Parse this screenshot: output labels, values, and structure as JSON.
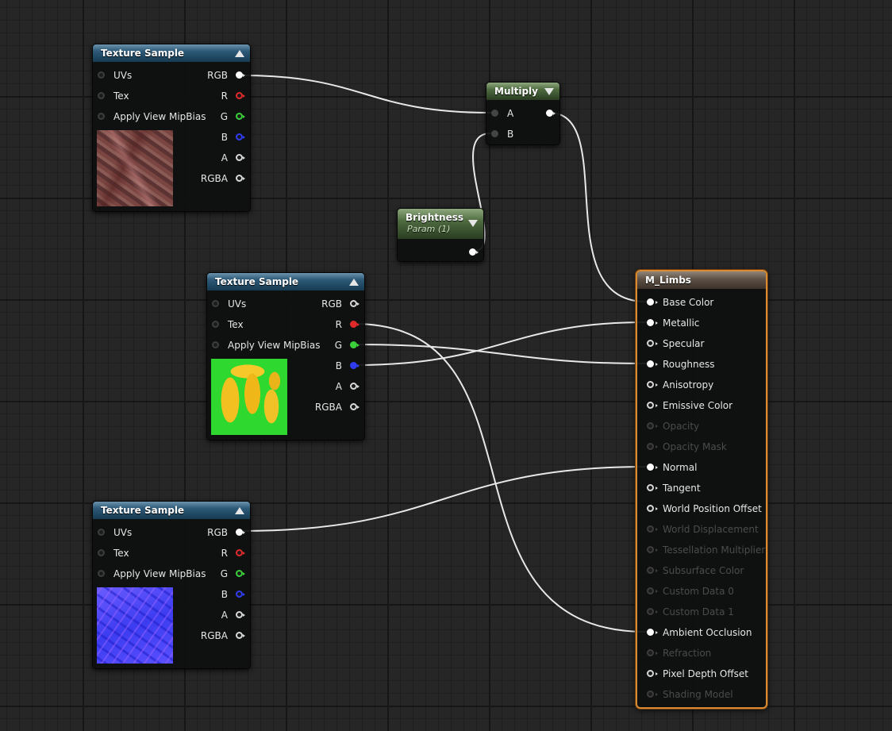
{
  "texture_sample_1": {
    "title": "Texture Sample",
    "inputs": [
      "UVs",
      "Tex",
      "Apply View MipBias"
    ],
    "outputs": [
      "RGB",
      "R",
      "G",
      "B",
      "A",
      "RGBA"
    ],
    "preview_icon": "texture-preview-diffuse"
  },
  "texture_sample_2": {
    "title": "Texture Sample",
    "inputs": [
      "UVs",
      "Tex",
      "Apply View MipBias"
    ],
    "outputs": [
      "RGB",
      "R",
      "G",
      "B",
      "A",
      "RGBA"
    ],
    "preview_icon": "texture-preview-mask"
  },
  "texture_sample_3": {
    "title": "Texture Sample",
    "inputs": [
      "UVs",
      "Tex",
      "Apply View MipBias"
    ],
    "outputs": [
      "RGB",
      "R",
      "G",
      "B",
      "A",
      "RGBA"
    ],
    "preview_icon": "texture-preview-normal"
  },
  "multiply": {
    "title": "Multiply",
    "inputs": [
      "A",
      "B"
    ]
  },
  "brightness": {
    "title": "Brightness",
    "subtitle": "Param (1)"
  },
  "material": {
    "title": "M_Limbs",
    "pins": [
      {
        "label": "Base Color",
        "enabled": true,
        "connected": true
      },
      {
        "label": "Metallic",
        "enabled": true,
        "connected": true
      },
      {
        "label": "Specular",
        "enabled": true,
        "connected": false
      },
      {
        "label": "Roughness",
        "enabled": true,
        "connected": true
      },
      {
        "label": "Anisotropy",
        "enabled": true,
        "connected": false
      },
      {
        "label": "Emissive Color",
        "enabled": true,
        "connected": false
      },
      {
        "label": "Opacity",
        "enabled": false,
        "connected": false
      },
      {
        "label": "Opacity Mask",
        "enabled": false,
        "connected": false
      },
      {
        "label": "Normal",
        "enabled": true,
        "connected": true
      },
      {
        "label": "Tangent",
        "enabled": true,
        "connected": false
      },
      {
        "label": "World Position Offset",
        "enabled": true,
        "connected": false
      },
      {
        "label": "World Displacement",
        "enabled": false,
        "connected": false
      },
      {
        "label": "Tessellation Multiplier",
        "enabled": false,
        "connected": false
      },
      {
        "label": "Subsurface Color",
        "enabled": false,
        "connected": false
      },
      {
        "label": "Custom Data 0",
        "enabled": false,
        "connected": false
      },
      {
        "label": "Custom Data 1",
        "enabled": false,
        "connected": false
      },
      {
        "label": "Ambient Occlusion",
        "enabled": true,
        "connected": true
      },
      {
        "label": "Refraction",
        "enabled": false,
        "connected": false
      },
      {
        "label": "Pixel Depth Offset",
        "enabled": true,
        "connected": false
      },
      {
        "label": "Shading Model",
        "enabled": false,
        "connected": false
      }
    ]
  },
  "colors": {
    "wire": "#e8e8e8",
    "header_texture": "#2d5a78",
    "header_multiply": "#4e6b40",
    "header_param": "#4e6b40",
    "header_material": "#5d5045",
    "material_border": "#d98a32",
    "pin_red": "#e02a2a",
    "pin_green": "#3ad03a",
    "pin_blue": "#2f3cf0"
  }
}
